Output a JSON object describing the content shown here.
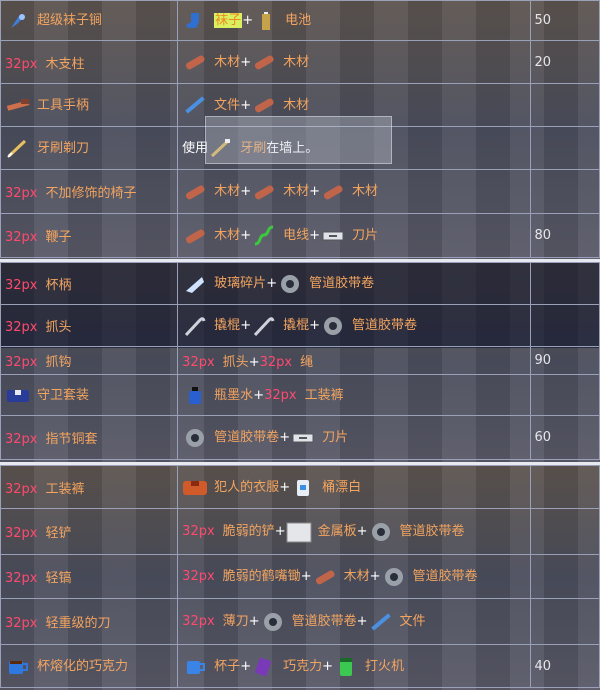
{
  "sections": [
    {
      "rows": [
        {
          "c1": [
            {
              "k": "icon",
              "n": "super-sock-mace-icon"
            },
            {
              "k": "txt",
              "v": "超级袜子锏"
            }
          ],
          "c2": [
            {
              "k": "icon",
              "n": "sock-icon"
            },
            {
              "k": "hl",
              "v": "袜子"
            },
            {
              "k": "plus",
              "v": "+"
            },
            {
              "k": "icon",
              "n": "battery-icon"
            },
            {
              "k": "txt",
              "v": "电池"
            }
          ],
          "c3": "50"
        },
        {
          "c1": [
            {
              "k": "ph",
              "v": "32px"
            },
            {
              "k": "txt",
              "v": "木支柱"
            }
          ],
          "c2": [
            {
              "k": "icon",
              "n": "timber-icon"
            },
            {
              "k": "txt",
              "v": "木材"
            },
            {
              "k": "plus",
              "v": "+"
            },
            {
              "k": "icon",
              "n": "timber-icon"
            },
            {
              "k": "txt",
              "v": "木材"
            }
          ],
          "c3": "20"
        },
        {
          "c1": [
            {
              "k": "icon",
              "n": "tool-handle-icon"
            },
            {
              "k": "txt",
              "v": "工具手柄"
            }
          ],
          "c2": [
            {
              "k": "icon",
              "n": "file-icon"
            },
            {
              "k": "txt",
              "v": "文件"
            },
            {
              "k": "plus",
              "v": "+"
            },
            {
              "k": "icon",
              "n": "timber-icon"
            },
            {
              "k": "txt",
              "v": "木材"
            }
          ],
          "c3": ""
        },
        {
          "c1": [
            {
              "k": "icon",
              "n": "toothbrush-shiv-icon"
            },
            {
              "k": "txt",
              "v": "牙刷剃刀"
            }
          ],
          "c2": [
            {
              "k": "wht",
              "v": "使用"
            },
            {
              "k": "icon",
              "n": "toothbrush-icon"
            },
            {
              "k": "txt",
              "v": "牙刷"
            },
            {
              "k": "wht",
              "v": "在墙上。"
            }
          ],
          "c3": ""
        },
        {
          "c1": [
            {
              "k": "ph",
              "v": "32px"
            },
            {
              "k": "txt",
              "v": "不加修饰的椅子"
            }
          ],
          "c2": [
            {
              "k": "icon",
              "n": "timber-icon"
            },
            {
              "k": "txt",
              "v": "木材"
            },
            {
              "k": "plus",
              "v": "+"
            },
            {
              "k": "icon",
              "n": "timber-icon"
            },
            {
              "k": "txt",
              "v": "木材"
            },
            {
              "k": "plus",
              "v": "+"
            },
            {
              "k": "icon",
              "n": "timber-icon"
            },
            {
              "k": "txt",
              "v": "木材"
            }
          ],
          "c3": ""
        },
        {
          "c1": [
            {
              "k": "ph",
              "v": "32px"
            },
            {
              "k": "txt",
              "v": "鞭子"
            }
          ],
          "c2": [
            {
              "k": "icon",
              "n": "timber-icon"
            },
            {
              "k": "txt",
              "v": "木材"
            },
            {
              "k": "plus",
              "v": "+"
            },
            {
              "k": "icon",
              "n": "wire-icon"
            },
            {
              "k": "txt",
              "v": "电线"
            },
            {
              "k": "plus",
              "v": "+"
            },
            {
              "k": "icon",
              "n": "razor-blade-icon"
            },
            {
              "k": "txt",
              "v": "刀片"
            }
          ],
          "c3": "80"
        }
      ]
    },
    {
      "rows": [
        {
          "c1": [
            {
              "k": "ph",
              "v": "32px"
            },
            {
              "k": "txt",
              "v": "杯柄"
            }
          ],
          "c2": [
            {
              "k": "icon",
              "n": "glass-shard-icon"
            },
            {
              "k": "txt",
              "v": "玻璃碎片"
            },
            {
              "k": "plus",
              "v": "+"
            },
            {
              "k": "icon",
              "n": "duct-tape-icon"
            },
            {
              "k": "txt",
              "v": "管道胶带卷"
            }
          ],
          "c3": ""
        },
        {
          "c1": [
            {
              "k": "ph",
              "v": "32px"
            },
            {
              "k": "txt",
              "v": "抓头"
            }
          ],
          "c2": [
            {
              "k": "icon",
              "n": "crowbar-icon"
            },
            {
              "k": "txt",
              "v": "撬棍"
            },
            {
              "k": "plus",
              "v": "+"
            },
            {
              "k": "icon",
              "n": "crowbar-icon"
            },
            {
              "k": "txt",
              "v": "撬棍"
            },
            {
              "k": "plus",
              "v": "+"
            },
            {
              "k": "icon",
              "n": "duct-tape-icon"
            },
            {
              "k": "txt",
              "v": "管道胶带卷"
            }
          ],
          "c3": ""
        },
        {
          "c1": [
            {
              "k": "ph",
              "v": "32px"
            },
            {
              "k": "txt",
              "v": "抓钩"
            }
          ],
          "c2": [
            {
              "k": "ph",
              "v": "32px"
            },
            {
              "k": "txt",
              "v": "抓头"
            },
            {
              "k": "plus",
              "v": "+"
            },
            {
              "k": "ph",
              "v": "32px"
            },
            {
              "k": "txt",
              "v": "绳"
            }
          ],
          "c3": "90"
        },
        {
          "c1": [
            {
              "k": "icon",
              "n": "guard-outfit-icon"
            },
            {
              "k": "txt",
              "v": "守卫套装"
            }
          ],
          "c2": [
            {
              "k": "icon",
              "n": "ink-bottle-icon"
            },
            {
              "k": "txt",
              "v": "瓶墨水"
            },
            {
              "k": "plus",
              "v": "+"
            },
            {
              "k": "ph",
              "v": "32px"
            },
            {
              "k": "txt",
              "v": "工装裤"
            }
          ],
          "c3": ""
        },
        {
          "c1": [
            {
              "k": "ph",
              "v": "32px"
            },
            {
              "k": "txt",
              "v": "指节铜套"
            }
          ],
          "c2": [
            {
              "k": "icon",
              "n": "duct-tape-icon"
            },
            {
              "k": "txt",
              "v": "管道胶带卷"
            },
            {
              "k": "plus",
              "v": "+"
            },
            {
              "k": "icon",
              "n": "razor-blade-icon"
            },
            {
              "k": "txt",
              "v": "刀片"
            }
          ],
          "c3": "60"
        }
      ]
    },
    {
      "rows": [
        {
          "c1": [
            {
              "k": "ph",
              "v": "32px"
            },
            {
              "k": "txt",
              "v": "工装裤"
            }
          ],
          "c2": [
            {
              "k": "icon",
              "n": "inmate-outfit-icon"
            },
            {
              "k": "txt",
              "v": "犯人的衣服"
            },
            {
              "k": "plus",
              "v": "+"
            },
            {
              "k": "icon",
              "n": "bleach-icon"
            },
            {
              "k": "txt",
              "v": "桶漂白"
            }
          ],
          "c3": ""
        },
        {
          "c1": [
            {
              "k": "ph",
              "v": "32px"
            },
            {
              "k": "txt",
              "v": "轻铲"
            }
          ],
          "c2": [
            {
              "k": "ph",
              "v": "32px"
            },
            {
              "k": "txt",
              "v": "脆弱的铲"
            },
            {
              "k": "plus",
              "v": "+"
            },
            {
              "k": "icon",
              "n": "metal-sheet-icon"
            },
            {
              "k": "txt",
              "v": "金属板"
            },
            {
              "k": "plus",
              "v": "+"
            },
            {
              "k": "icon",
              "n": "duct-tape-icon"
            },
            {
              "k": "txt",
              "v": "管道胶带卷"
            }
          ],
          "c3": ""
        },
        {
          "c1": [
            {
              "k": "ph",
              "v": "32px"
            },
            {
              "k": "txt",
              "v": "轻镐"
            }
          ],
          "c2": [
            {
              "k": "ph",
              "v": "32px"
            },
            {
              "k": "txt",
              "v": "脆弱的鹤嘴锄"
            },
            {
              "k": "plus",
              "v": "+"
            },
            {
              "k": "icon",
              "n": "timber-icon"
            },
            {
              "k": "txt",
              "v": "木材"
            },
            {
              "k": "plus",
              "v": "+"
            },
            {
              "k": "icon",
              "n": "duct-tape-icon"
            },
            {
              "k": "txt",
              "v": "管道胶带卷"
            }
          ],
          "c3": ""
        },
        {
          "c1": [
            {
              "k": "ph",
              "v": "32px"
            },
            {
              "k": "txt",
              "v": "轻重级的刀"
            }
          ],
          "c2": [
            {
              "k": "ph",
              "v": "32px"
            },
            {
              "k": "txt",
              "v": "薄刀"
            },
            {
              "k": "plus",
              "v": "+"
            },
            {
              "k": "icon",
              "n": "duct-tape-icon"
            },
            {
              "k": "txt",
              "v": "管道胶带卷"
            },
            {
              "k": "plus",
              "v": "+"
            },
            {
              "k": "icon",
              "n": "file-icon"
            },
            {
              "k": "txt",
              "v": "文件"
            }
          ],
          "c3": ""
        },
        {
          "c1": [
            {
              "k": "icon",
              "n": "molten-chocolate-cup-icon"
            },
            {
              "k": "txt",
              "v": "杯熔化的巧克力"
            }
          ],
          "c2": [
            {
              "k": "icon",
              "n": "cup-icon"
            },
            {
              "k": "txt",
              "v": "杯子"
            },
            {
              "k": "plus",
              "v": "+"
            },
            {
              "k": "icon",
              "n": "chocolate-icon"
            },
            {
              "k": "txt",
              "v": "巧克力"
            },
            {
              "k": "plus",
              "v": "+"
            },
            {
              "k": "icon",
              "n": "lighter-icon"
            },
            {
              "k": "txt",
              "v": "打火机"
            }
          ],
          "c3": "40"
        }
      ]
    }
  ]
}
